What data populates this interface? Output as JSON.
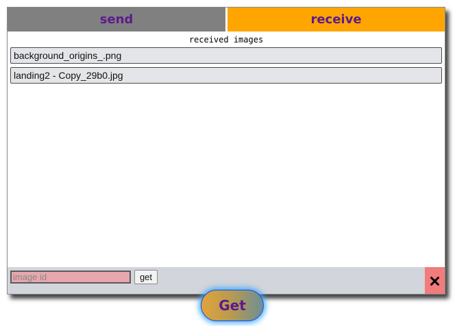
{
  "tabs": {
    "send": "send",
    "receive": "receive"
  },
  "received": {
    "title": "received images",
    "files": [
      "background_origins_.png",
      "landing2 - Copy_29b0.jpg"
    ]
  },
  "bottom_bar": {
    "image_id_placeholder": "image id",
    "image_id_value": "",
    "get_label": "get",
    "close_icon": "close-icon"
  },
  "get_button": {
    "label": "Get"
  },
  "colors": {
    "tab_send_bg": "#808080",
    "tab_receive_bg": "#ffa500",
    "tab_text": "#5b1a8e",
    "close_bg": "#f27b7b",
    "input_bg": "#e7a7ad"
  }
}
